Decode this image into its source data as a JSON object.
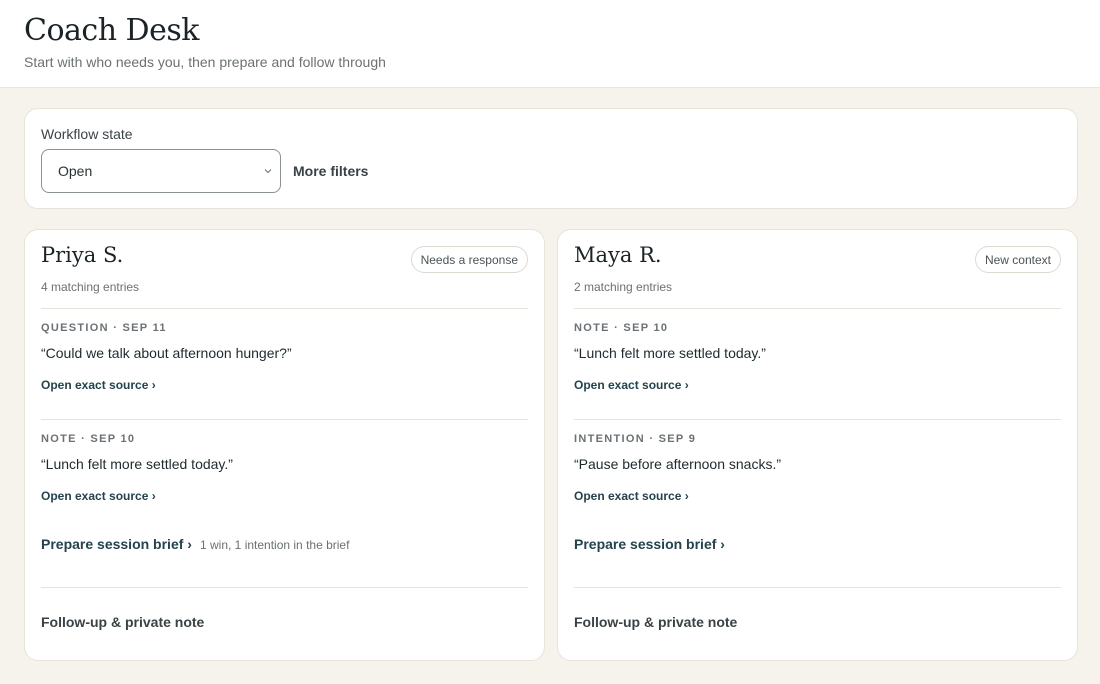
{
  "header": {
    "title": "Coach Desk",
    "subtitle": "Start with who needs you, then prepare and follow through"
  },
  "filters": {
    "label": "Workflow state",
    "selected": "Open",
    "more_filters": "More filters"
  },
  "clients": [
    {
      "name": "Priya S.",
      "count": "4 matching entries",
      "badge": "Needs a response",
      "entries": [
        {
          "meta": "QUESTION · SEP 11",
          "quote": "“Could we talk about afternoon hunger?”",
          "link": "Open exact source ›"
        },
        {
          "meta": "NOTE · SEP 10",
          "quote": "“Lunch felt more settled today.”",
          "link": "Open exact source ›"
        }
      ],
      "brief": "Prepare session brief ›",
      "brief_note": "1 win, 1 intention in the brief",
      "followup": "Follow-up & private note"
    },
    {
      "name": "Maya R.",
      "count": "2 matching entries",
      "badge": "New context",
      "entries": [
        {
          "meta": "NOTE · SEP 10",
          "quote": "“Lunch felt more settled today.”",
          "link": "Open exact source ›"
        },
        {
          "meta": "INTENTION · SEP 9",
          "quote": "“Pause before afternoon snacks.”",
          "link": "Open exact source ›"
        }
      ],
      "brief": "Prepare session brief ›",
      "followup": "Follow-up & private note"
    }
  ]
}
